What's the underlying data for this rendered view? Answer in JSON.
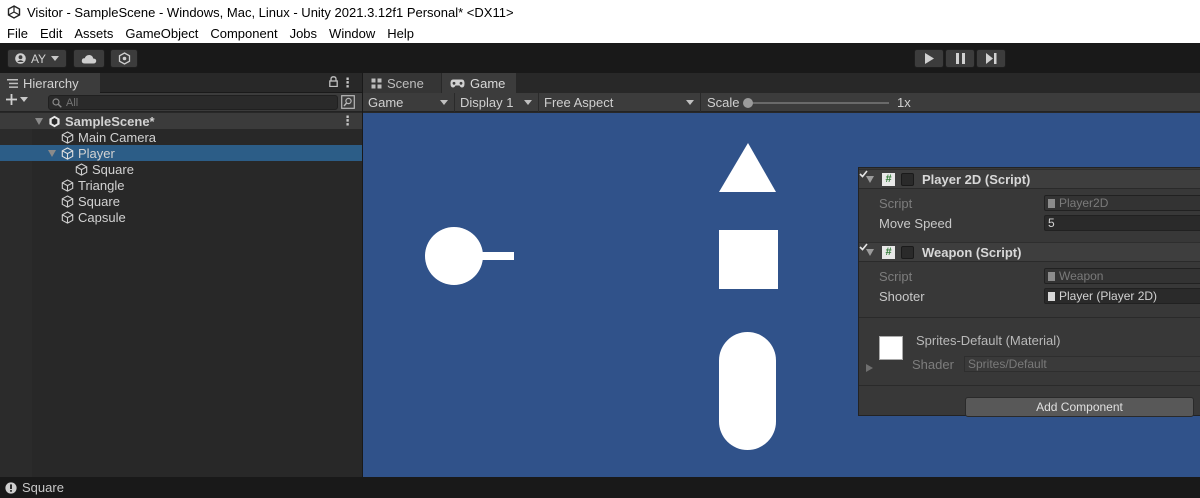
{
  "window": {
    "title": "Visitor - SampleScene - Windows, Mac, Linux - Unity 2021.3.12f1 Personal* <DX11>"
  },
  "menu": [
    "File",
    "Edit",
    "Assets",
    "GameObject",
    "Component",
    "Jobs",
    "Window",
    "Help"
  ],
  "toolbar": {
    "account_label": "AY"
  },
  "hierarchy": {
    "tab_label": "Hierarchy",
    "search_placeholder": "All",
    "scene": "SampleScene*",
    "items": [
      {
        "label": "Main Camera"
      },
      {
        "label": "Player",
        "selected": true,
        "expanded": true
      },
      {
        "label": "Square"
      },
      {
        "label": "Triangle"
      },
      {
        "label": "Square"
      },
      {
        "label": "Capsule"
      }
    ]
  },
  "game_view": {
    "tabs": [
      {
        "label": "Scene",
        "icon": "scene-grid-icon"
      },
      {
        "label": "Game",
        "icon": "gamepad-icon",
        "active": true
      }
    ],
    "game_dropdown": "Game",
    "display_dropdown": "Display 1",
    "aspect_dropdown": "Free Aspect",
    "scale_label": "Scale",
    "scale_value": "1x",
    "background_color": "#30528a"
  },
  "inspector": {
    "components": [
      {
        "title": "Player 2D (Script)",
        "enabled": true,
        "props": [
          {
            "label": "Script",
            "value": "Player2D"
          },
          {
            "label": "Move Speed",
            "value": "5"
          }
        ]
      },
      {
        "title": "Weapon (Script)",
        "enabled": true,
        "props": [
          {
            "label": "Script",
            "value": "Weapon"
          },
          {
            "label": "Shooter",
            "value": "Player (Player 2D)"
          }
        ]
      }
    ],
    "material": {
      "name": "Sprites-Default (Material)",
      "shader_label": "Shader",
      "shader_value": "Sprites/Default"
    },
    "add_component_label": "Add Component"
  },
  "status": {
    "text": "Square"
  }
}
